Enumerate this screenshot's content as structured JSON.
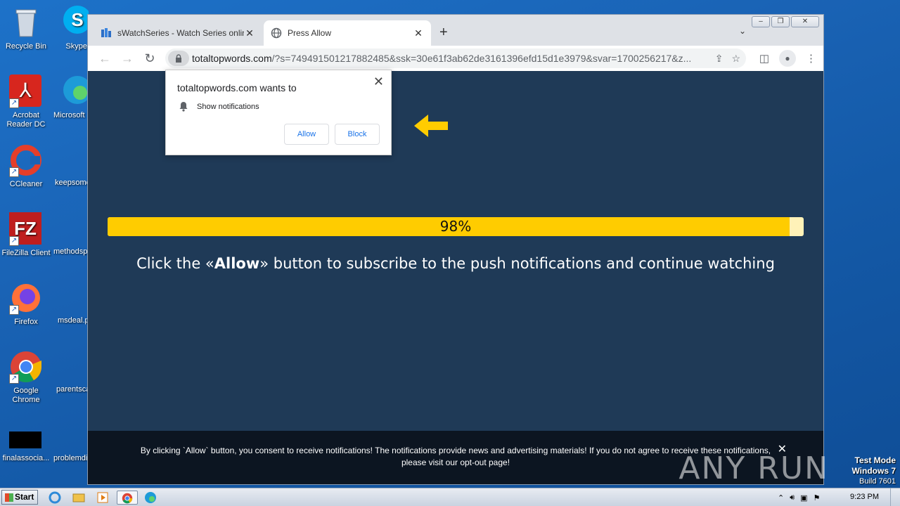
{
  "desktop": {
    "icons": [
      {
        "label": "Recycle Bin"
      },
      {
        "label": "Acrobat Reader DC"
      },
      {
        "label": "CCleaner"
      },
      {
        "label": "FileZilla Client"
      },
      {
        "label": "Firefox"
      },
      {
        "label": "Google Chrome"
      },
      {
        "label": "finalassocia..."
      }
    ],
    "col2": [
      "Skype",
      "Microsoft",
      "keepsome",
      "methodsp",
      "msdeal.p",
      "parentsca",
      "problemdi"
    ]
  },
  "browser": {
    "tabs": [
      {
        "label": "sWatchSeries - Watch Series online,",
        "active": false
      },
      {
        "label": "Press Allow",
        "active": true
      }
    ],
    "url_host": "totaltopwords.com",
    "url_rest": "/?s=749491501217882485&ssk=30e61f3ab62de3161396efd15d1e3979&svar=1700256217&z...",
    "window_controls": {
      "minimize": "–",
      "restore": "❐",
      "close": "✕"
    }
  },
  "popup": {
    "title": "totaltopwords.com wants to",
    "permission": "Show notifications",
    "allow_label": "Allow",
    "block_label": "Block",
    "close_label": "✕"
  },
  "page": {
    "progress_text": "98%",
    "progress_value": 98,
    "message_pre": "Click the «",
    "message_bold": "Allow",
    "message_post": "» button to subscribe to the push notifications and continue watching",
    "footer_text": "By clicking `Allow` button, you consent to receive notifications! The notifications provide news and advertising materials! If you do not agree to receive these notifications,",
    "footer_text2_pre": "please visit our ",
    "footer_link": "opt-out page",
    "footer_text2_post": "!",
    "footer_close": "✕",
    "accent_yellow": "#ffcc00",
    "background": "#1f3a57"
  },
  "watermark": "ANY RUN",
  "taskbar": {
    "start_label": "Start",
    "clock": "9:23 PM"
  },
  "testmode": {
    "line1": "Test Mode",
    "line2": "Windows 7",
    "line3": "Build 7601"
  }
}
